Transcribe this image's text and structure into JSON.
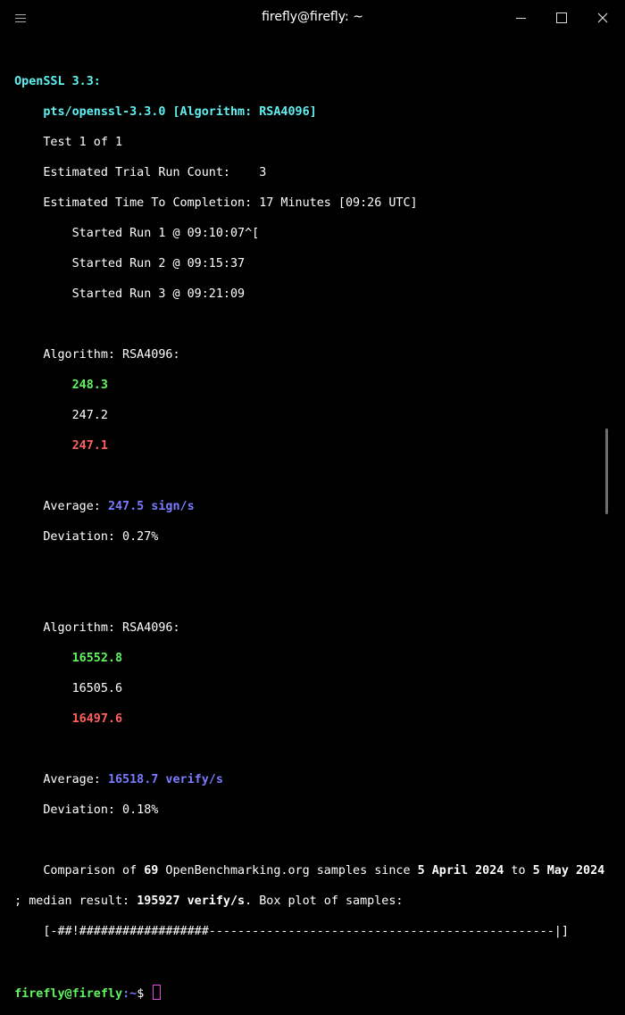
{
  "window": {
    "title": "firefly@firefly: ~"
  },
  "terminal": {
    "header": "OpenSSL 3.3:",
    "test_name": "pts/openssl-3.3.0 [Algorithm: RSA4096]",
    "test_index": "Test 1 of 1",
    "trial_count_label": "Estimated Trial Run Count:",
    "trial_count_value": "3",
    "eta_label": "Estimated Time To Completion:",
    "eta_value": "17 Minutes [09:26 UTC]",
    "runs": [
      "Started Run 1 @ 09:10:07^[",
      "Started Run 2 @ 09:15:37",
      "Started Run 3 @ 09:21:09"
    ],
    "sign": {
      "algorithm_label": "Algorithm: RSA4096:",
      "results": [
        "248.3",
        "247.2",
        "247.1"
      ],
      "average_label": "Average:",
      "average_value": "247.5 sign/s",
      "deviation": "Deviation: 0.27%"
    },
    "verify": {
      "algorithm_label": "Algorithm: RSA4096:",
      "results": [
        "16552.8",
        "16505.6",
        "16497.6"
      ],
      "average_label": "Average:",
      "average_value": "16518.7 verify/s",
      "deviation": "Deviation: 0.18%"
    },
    "comparison": {
      "t1": "Comparison of ",
      "samples": "69",
      "t2": " OpenBenchmarking.org samples since ",
      "from": "5 April 2024",
      "t3": " to ",
      "to": "5 May 2024",
      "t4": "; median result: ",
      "median": "195927 verify/s",
      "t5": ". Box plot of samples:",
      "boxplot": "[-##!##################------------------------------------------------|]"
    },
    "prompt": {
      "user_host": "firefly@firefly",
      "path": ":~",
      "symbol": "$ "
    }
  },
  "colors": {
    "background": "#000000",
    "header_cyan": "#5ff1f1",
    "best_green": "#5ff55f",
    "worst_red": "#ff5f5f",
    "average_blue": "#7b7bff",
    "cursor": "#e04ae0"
  }
}
